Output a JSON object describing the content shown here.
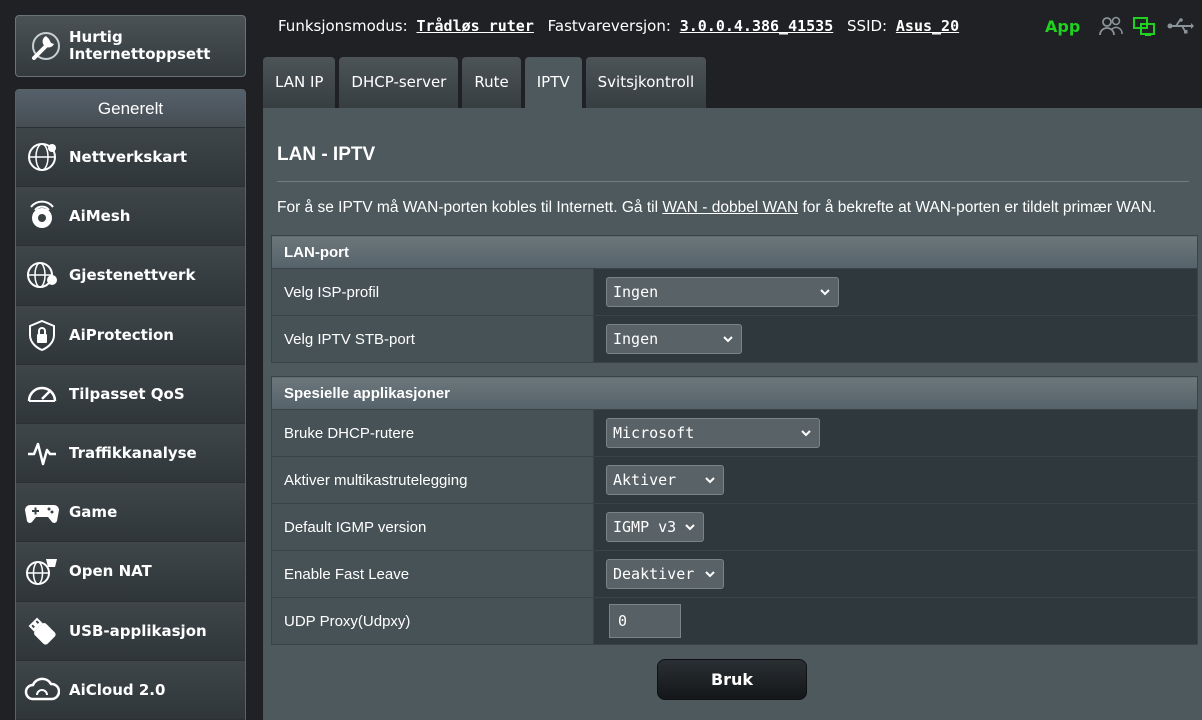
{
  "sidebar": {
    "quick_setup_line1": "Hurtig",
    "quick_setup_line2": "Internettoppsett",
    "section_header": "Generelt",
    "items": [
      {
        "label": "Nettverkskart"
      },
      {
        "label": "AiMesh"
      },
      {
        "label": "Gjestenettverk"
      },
      {
        "label": "AiProtection"
      },
      {
        "label": "Tilpasset QoS"
      },
      {
        "label": "Traffikkanalyse"
      },
      {
        "label": "Game"
      },
      {
        "label": "Open NAT"
      },
      {
        "label": "USB-applikasjon"
      },
      {
        "label": "AiCloud 2.0"
      }
    ]
  },
  "topbar": {
    "mode_label": "Funksjonsmodus:",
    "mode_value": "Trådløs ruter",
    "firmware_label": "Fastvareversjon:",
    "firmware_value": "3.0.0.4.386_41535",
    "ssid_label": "SSID:",
    "ssid_value": "Asus_20",
    "app_label": "App"
  },
  "tabs": [
    {
      "label": "LAN IP"
    },
    {
      "label": "DHCP-server"
    },
    {
      "label": "Rute"
    },
    {
      "label": "IPTV",
      "active": true
    },
    {
      "label": "Svitsjkontroll"
    }
  ],
  "page": {
    "title": "LAN - IPTV",
    "desc_before": "For å se IPTV må WAN-porten kobles til Internett. Gå til ",
    "desc_link": "WAN - dobbel WAN",
    "desc_after": " for å bekrefte at WAN-porten er tildelt primær WAN."
  },
  "lan_port": {
    "header": "LAN-port",
    "rows": [
      {
        "label": "Velg ISP-profil",
        "value": "Ingen"
      },
      {
        "label": "Velg IPTV STB-port",
        "value": "Ingen"
      }
    ]
  },
  "special_apps": {
    "header": "Spesielle applikasjoner",
    "rows": [
      {
        "label": "Bruke DHCP-rutere",
        "value": "Microsoft"
      },
      {
        "label": "Aktiver multikastrutelegging",
        "value": "Aktiver"
      },
      {
        "label": "Default IGMP version",
        "value": "IGMP v3"
      },
      {
        "label": "Enable Fast Leave",
        "value": "Deaktiver"
      },
      {
        "label": "UDP Proxy(Udpxy)",
        "value": "0"
      }
    ]
  },
  "apply_label": "Bruk",
  "colors": {
    "accent_green": "#1ed21e",
    "panel": "#4d595d",
    "background": "#1f2124"
  }
}
